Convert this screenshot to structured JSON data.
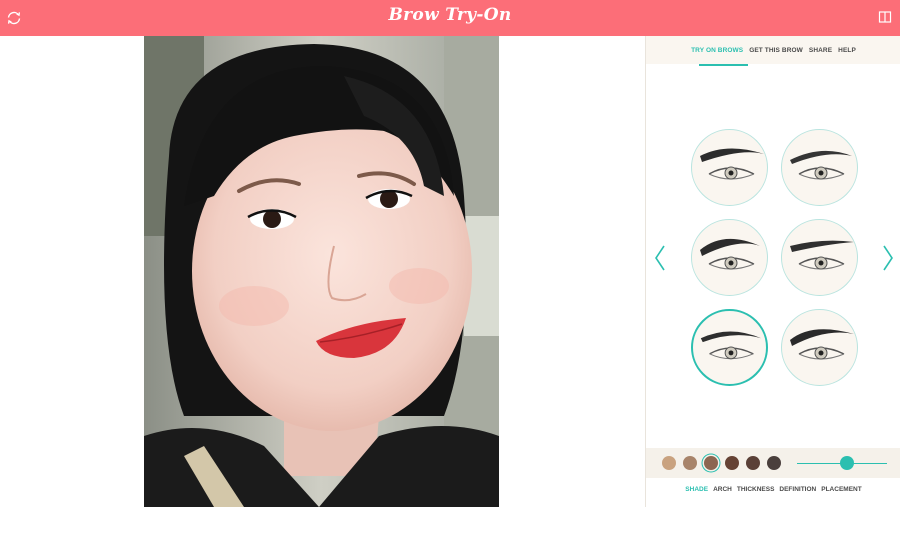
{
  "app": {
    "title": "Brow Try-On",
    "accent_color": "#fc6e78",
    "highlight_color": "#2bbfb0"
  },
  "header": {
    "left_icon": "refresh-icon",
    "right_icon": "panel-toggle-icon"
  },
  "tabs": [
    {
      "label": "TRY ON BROWS",
      "active": true
    },
    {
      "label": "GET THIS BROW",
      "active": false
    },
    {
      "label": "SHARE",
      "active": false
    },
    {
      "label": "HELP",
      "active": false
    }
  ],
  "carousel": {
    "prev_icon": "chevron-left-icon",
    "next_icon": "chevron-right-icon",
    "options": [
      {
        "style": "bold-straight",
        "selected": false
      },
      {
        "style": "soft-arched",
        "selected": false
      },
      {
        "style": "full-arched",
        "selected": false
      },
      {
        "style": "straight-tapered",
        "selected": false
      },
      {
        "style": "thin-rounded",
        "selected": true
      },
      {
        "style": "high-arched",
        "selected": false
      }
    ]
  },
  "shades": [
    {
      "color": "#c9a27f",
      "selected": false
    },
    {
      "color": "#a8846a",
      "selected": false
    },
    {
      "color": "#8c6650",
      "selected": true
    },
    {
      "color": "#654234",
      "selected": false
    },
    {
      "color": "#5a4037",
      "selected": false
    },
    {
      "color": "#4a3f3c",
      "selected": false
    }
  ],
  "intensity": {
    "value": 0.55
  },
  "properties": [
    {
      "label": "SHADE",
      "active": true
    },
    {
      "label": "ARCH",
      "active": false
    },
    {
      "label": "THICKNESS",
      "active": false
    },
    {
      "label": "DEFINITION",
      "active": false
    },
    {
      "label": "PLACEMENT",
      "active": false
    }
  ]
}
